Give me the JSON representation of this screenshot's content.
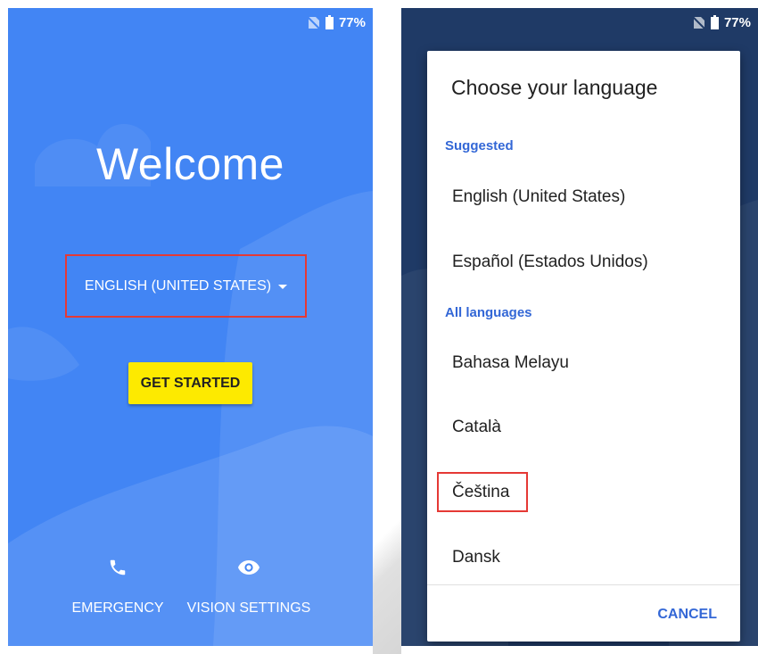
{
  "status": {
    "battery": "77%"
  },
  "welcome": {
    "title": "Welcome",
    "language": "ENGLISH (UNITED STATES)",
    "get_started": "GET STARTED",
    "emergency": "EMERGENCY",
    "vision_settings": "VISION SETTINGS"
  },
  "dialog": {
    "title": "Choose your language",
    "suggested_header": "Suggested",
    "suggested": [
      "English (United States)",
      "Español (Estados Unidos)"
    ],
    "all_header": "All languages",
    "all": [
      "Bahasa Melayu",
      "Català",
      "Čeština",
      "Dansk"
    ],
    "cancel": "CANCEL"
  },
  "colors": {
    "primary_blue": "#4285f4",
    "dark_bg": "#1f3a66",
    "accent_blue": "#3367d6",
    "button_yellow": "#fdea00",
    "highlight_red": "#e53935"
  }
}
